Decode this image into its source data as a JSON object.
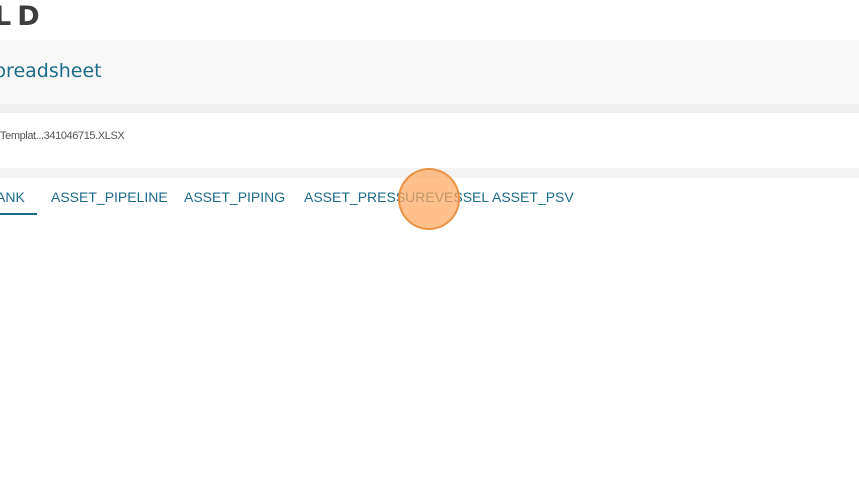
{
  "header": {
    "logo_text": "LD"
  },
  "page": {
    "title": "preadsheet"
  },
  "file": {
    "name": "Templat...341046715.XLSX"
  },
  "tabs": [
    {
      "label": "ANK",
      "active": true
    },
    {
      "label": "ASSET_PIPELINE",
      "active": false
    },
    {
      "label": "ASSET_PIPING",
      "active": false
    },
    {
      "label": "ASSET_PRESSUREVESSEL",
      "active": false
    },
    {
      "label": "ASSET_PSV",
      "active": false
    }
  ],
  "colors": {
    "accent": "#1c6b8a",
    "click_marker": "#ffa860"
  }
}
